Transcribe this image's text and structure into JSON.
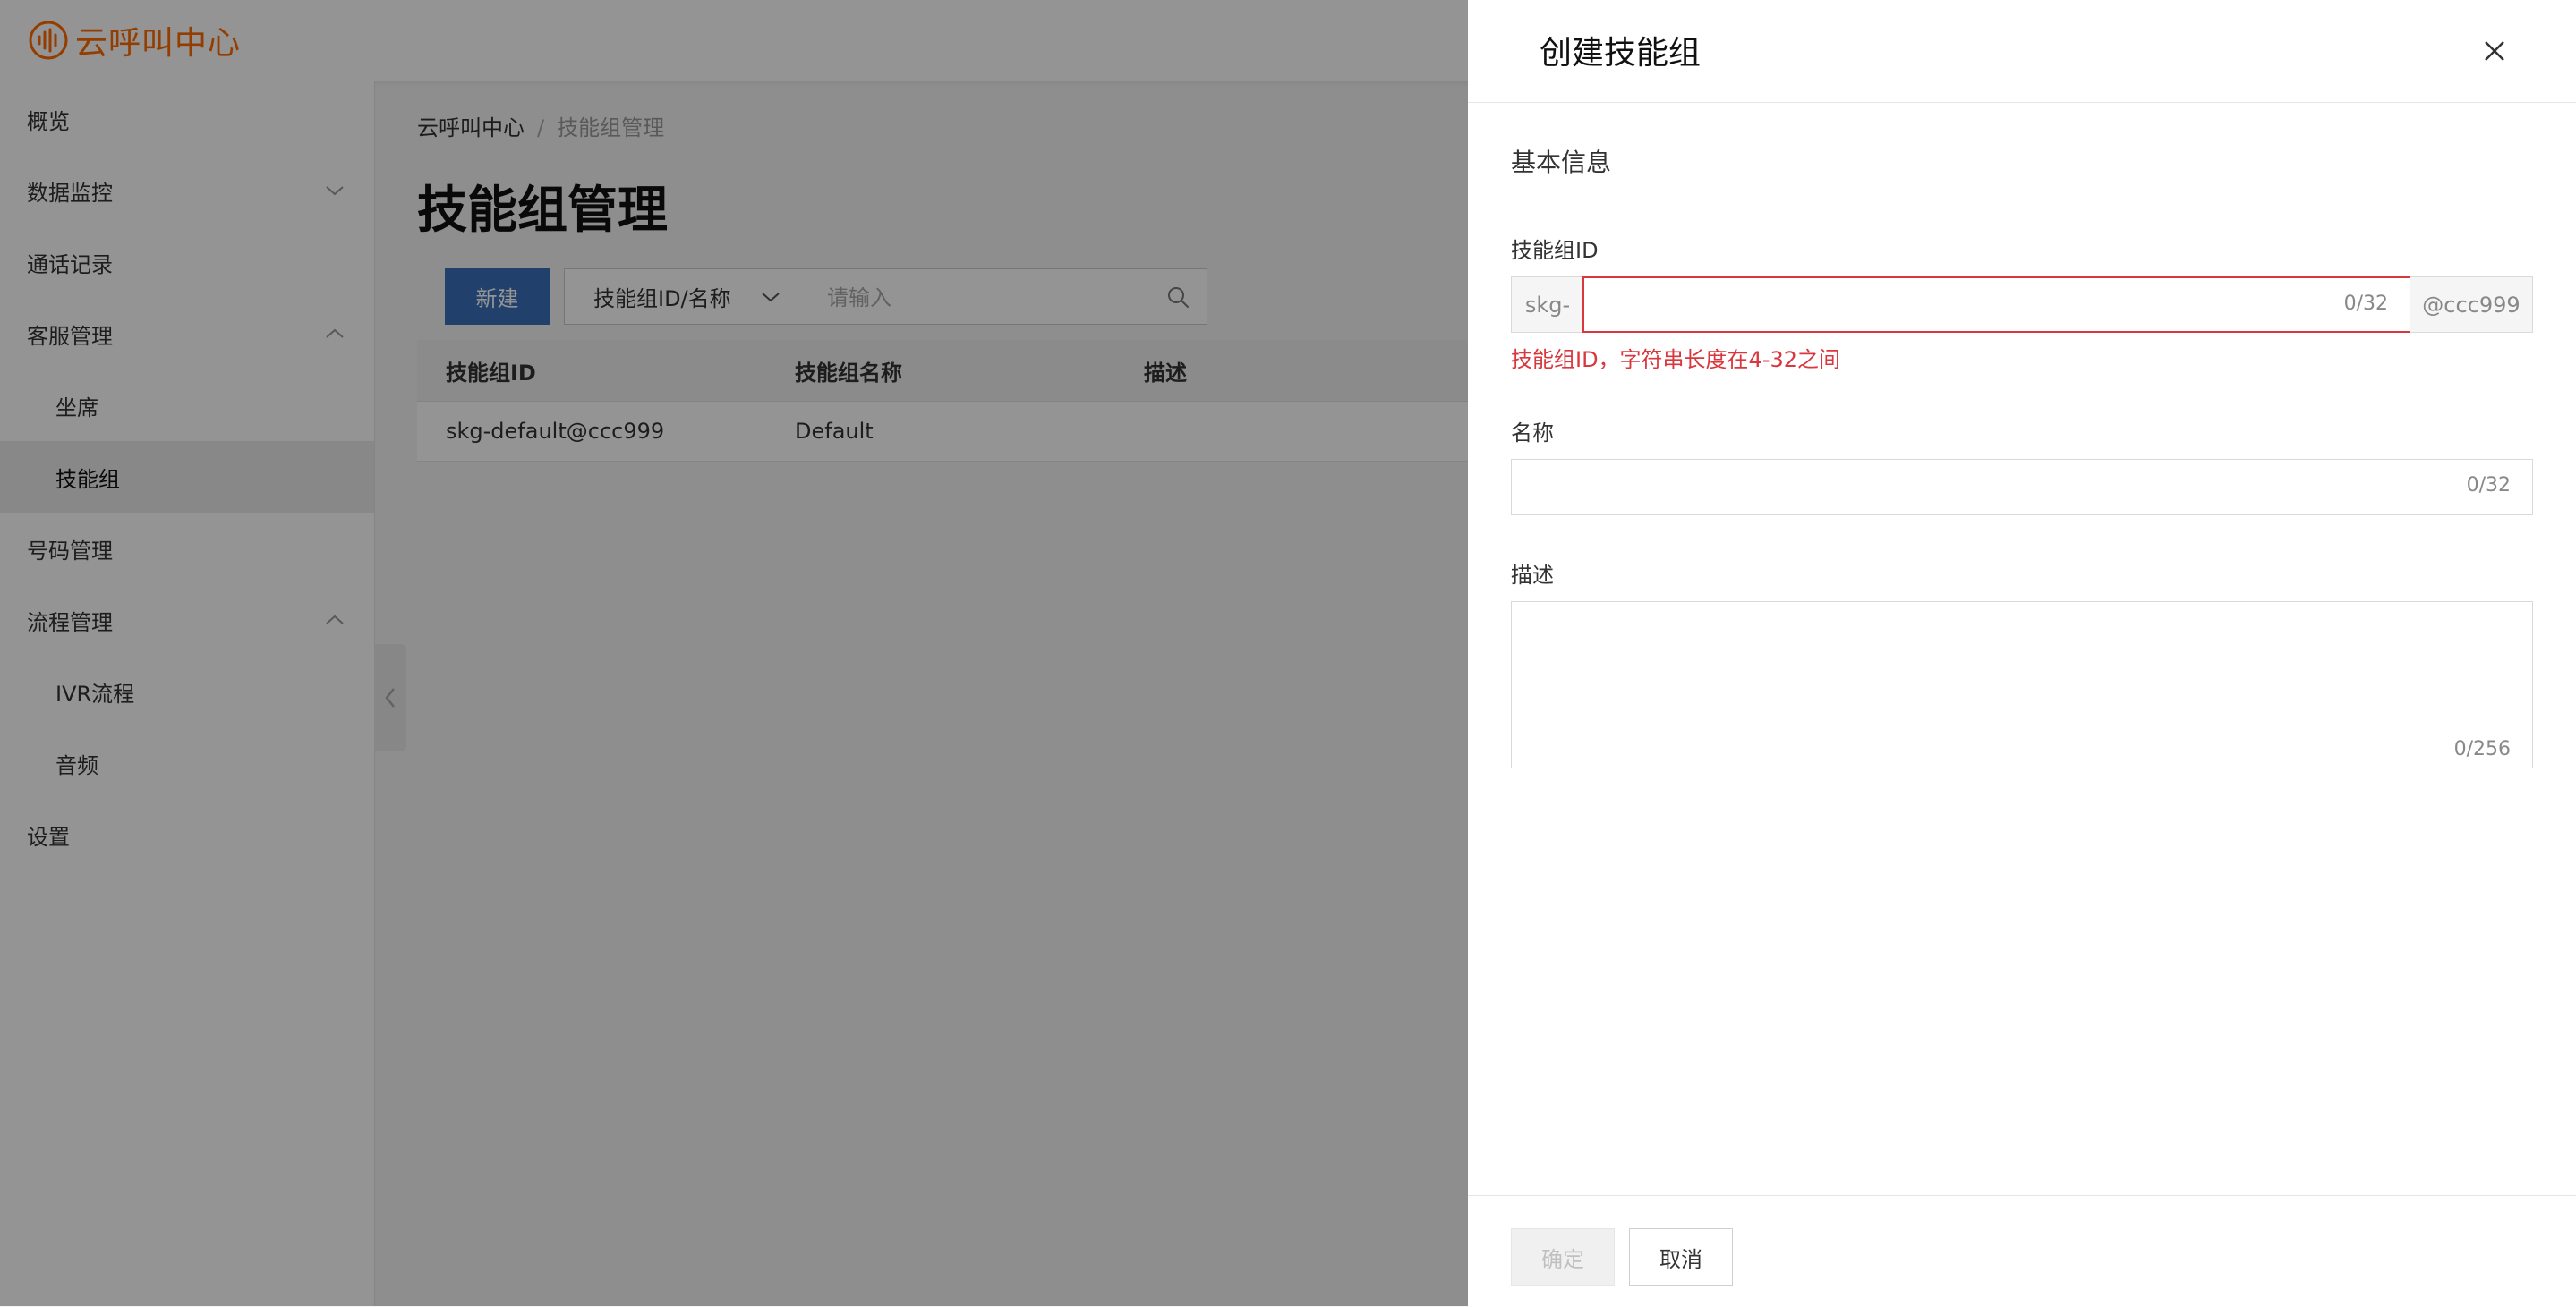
{
  "app": {
    "logo_text": "云呼叫中心",
    "logo_icon": "sound-wave-icon",
    "brand_color": "#ff6a00"
  },
  "sidebar": {
    "items": [
      {
        "label": "概览"
      },
      {
        "label": "数据监控",
        "icon": "chevron-down-icon"
      },
      {
        "label": "通话记录"
      },
      {
        "label": "客服管理",
        "icon": "chevron-up-icon"
      },
      {
        "label": "坐席"
      },
      {
        "label": "技能组",
        "active": true
      },
      {
        "label": "号码管理"
      },
      {
        "label": "流程管理",
        "icon": "chevron-up-icon"
      },
      {
        "label": "IVR流程"
      },
      {
        "label": "音频"
      },
      {
        "label": "设置"
      }
    ]
  },
  "breadcrumb": {
    "root": "云呼叫中心",
    "separator": "/",
    "current": "技能组管理"
  },
  "page": {
    "title": "技能组管理"
  },
  "toolbar": {
    "new_label": "新建",
    "filter_selected": "技能组ID/名称",
    "search_placeholder": "请输入"
  },
  "table": {
    "columns": [
      "技能组ID",
      "技能组名称",
      "描述"
    ],
    "rows": [
      {
        "id": "skg-default@ccc999",
        "name": "Default",
        "desc": ""
      }
    ]
  },
  "drawer": {
    "title": "创建技能组",
    "section": "基本信息",
    "fields": {
      "id": {
        "label": "技能组ID",
        "prefix": "skg-",
        "suffix": "@ccc999",
        "value": "",
        "counter": "0/32",
        "error": "技能组ID，字符串长度在4-32之间"
      },
      "name": {
        "label": "名称",
        "value": "",
        "counter": "0/32"
      },
      "desc": {
        "label": "描述",
        "value": "",
        "counter": "0/256"
      }
    },
    "ok_label": "确定",
    "cancel_label": "取消"
  },
  "colors": {
    "primary": "#3a6fb8",
    "error": "#d9363e"
  }
}
